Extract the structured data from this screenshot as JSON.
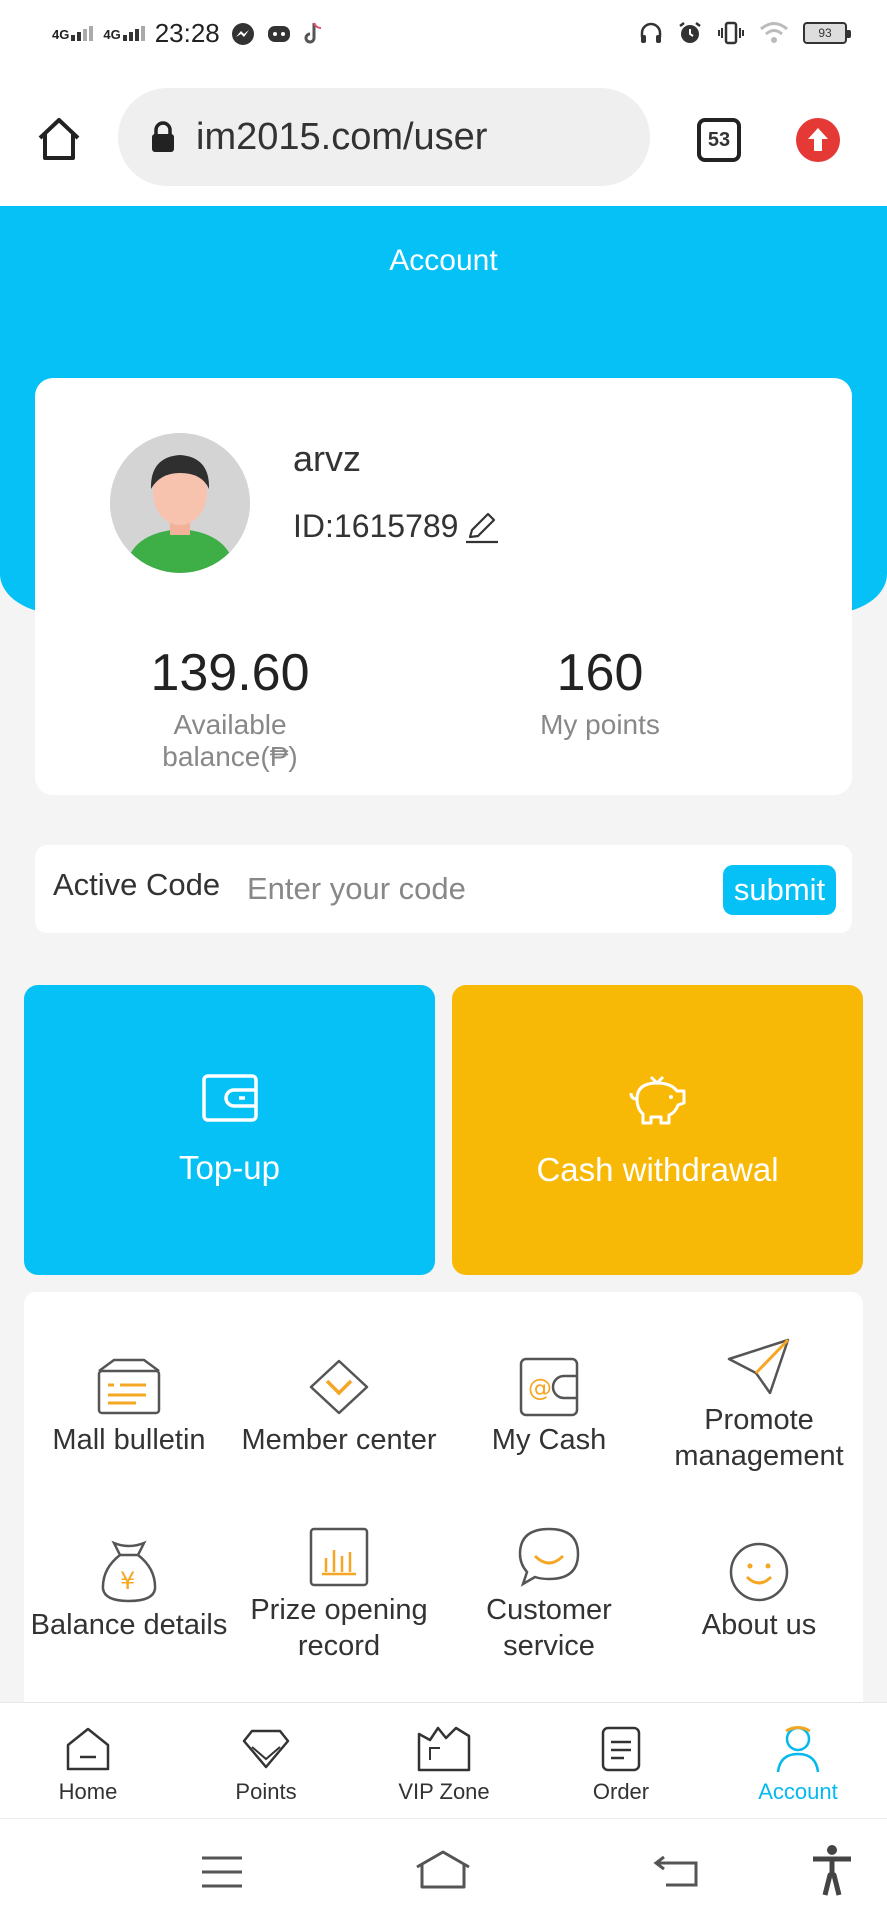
{
  "status_bar": {
    "network1": "4G",
    "network2": "4G",
    "time": "23:28",
    "battery": "93"
  },
  "browser": {
    "url": "im2015.com/user",
    "tab_count": "53"
  },
  "header": {
    "title": "Account"
  },
  "profile": {
    "username": "arvz",
    "id_text": "ID:1615789",
    "balance_value": "139.60",
    "balance_label": "Available balance(₱)",
    "points_value": "160",
    "points_label": "My points"
  },
  "active_code": {
    "label": "Active Code",
    "placeholder": "Enter your code",
    "submit_label": "submit"
  },
  "actions": {
    "topup_label": "Top-up",
    "withdraw_label": "Cash withdrawal"
  },
  "menu": [
    {
      "label": "Mall bulletin",
      "icon": "bulletin-icon"
    },
    {
      "label": "Member center",
      "icon": "diamond-icon"
    },
    {
      "label": "My Cash",
      "icon": "wallet-icon"
    },
    {
      "label": "Promote management",
      "icon": "paper-plane-icon"
    },
    {
      "label": "Balance details",
      "icon": "money-bag-icon"
    },
    {
      "label": "Prize opening record",
      "icon": "chart-icon"
    },
    {
      "label": "Customer service",
      "icon": "chat-icon"
    },
    {
      "label": "About us",
      "icon": "smile-icon"
    }
  ],
  "tabbar": [
    {
      "label": "Home",
      "icon": "home-icon"
    },
    {
      "label": "Points",
      "icon": "diamond-icon"
    },
    {
      "label": "VIP Zone",
      "icon": "vip-icon"
    },
    {
      "label": "Order",
      "icon": "order-icon"
    },
    {
      "label": "Account",
      "icon": "account-icon",
      "active": true
    }
  ],
  "colors": {
    "accent_blue": "#05c1f5",
    "accent_yellow": "#f8b906",
    "icon_orange": "#f5a623"
  }
}
